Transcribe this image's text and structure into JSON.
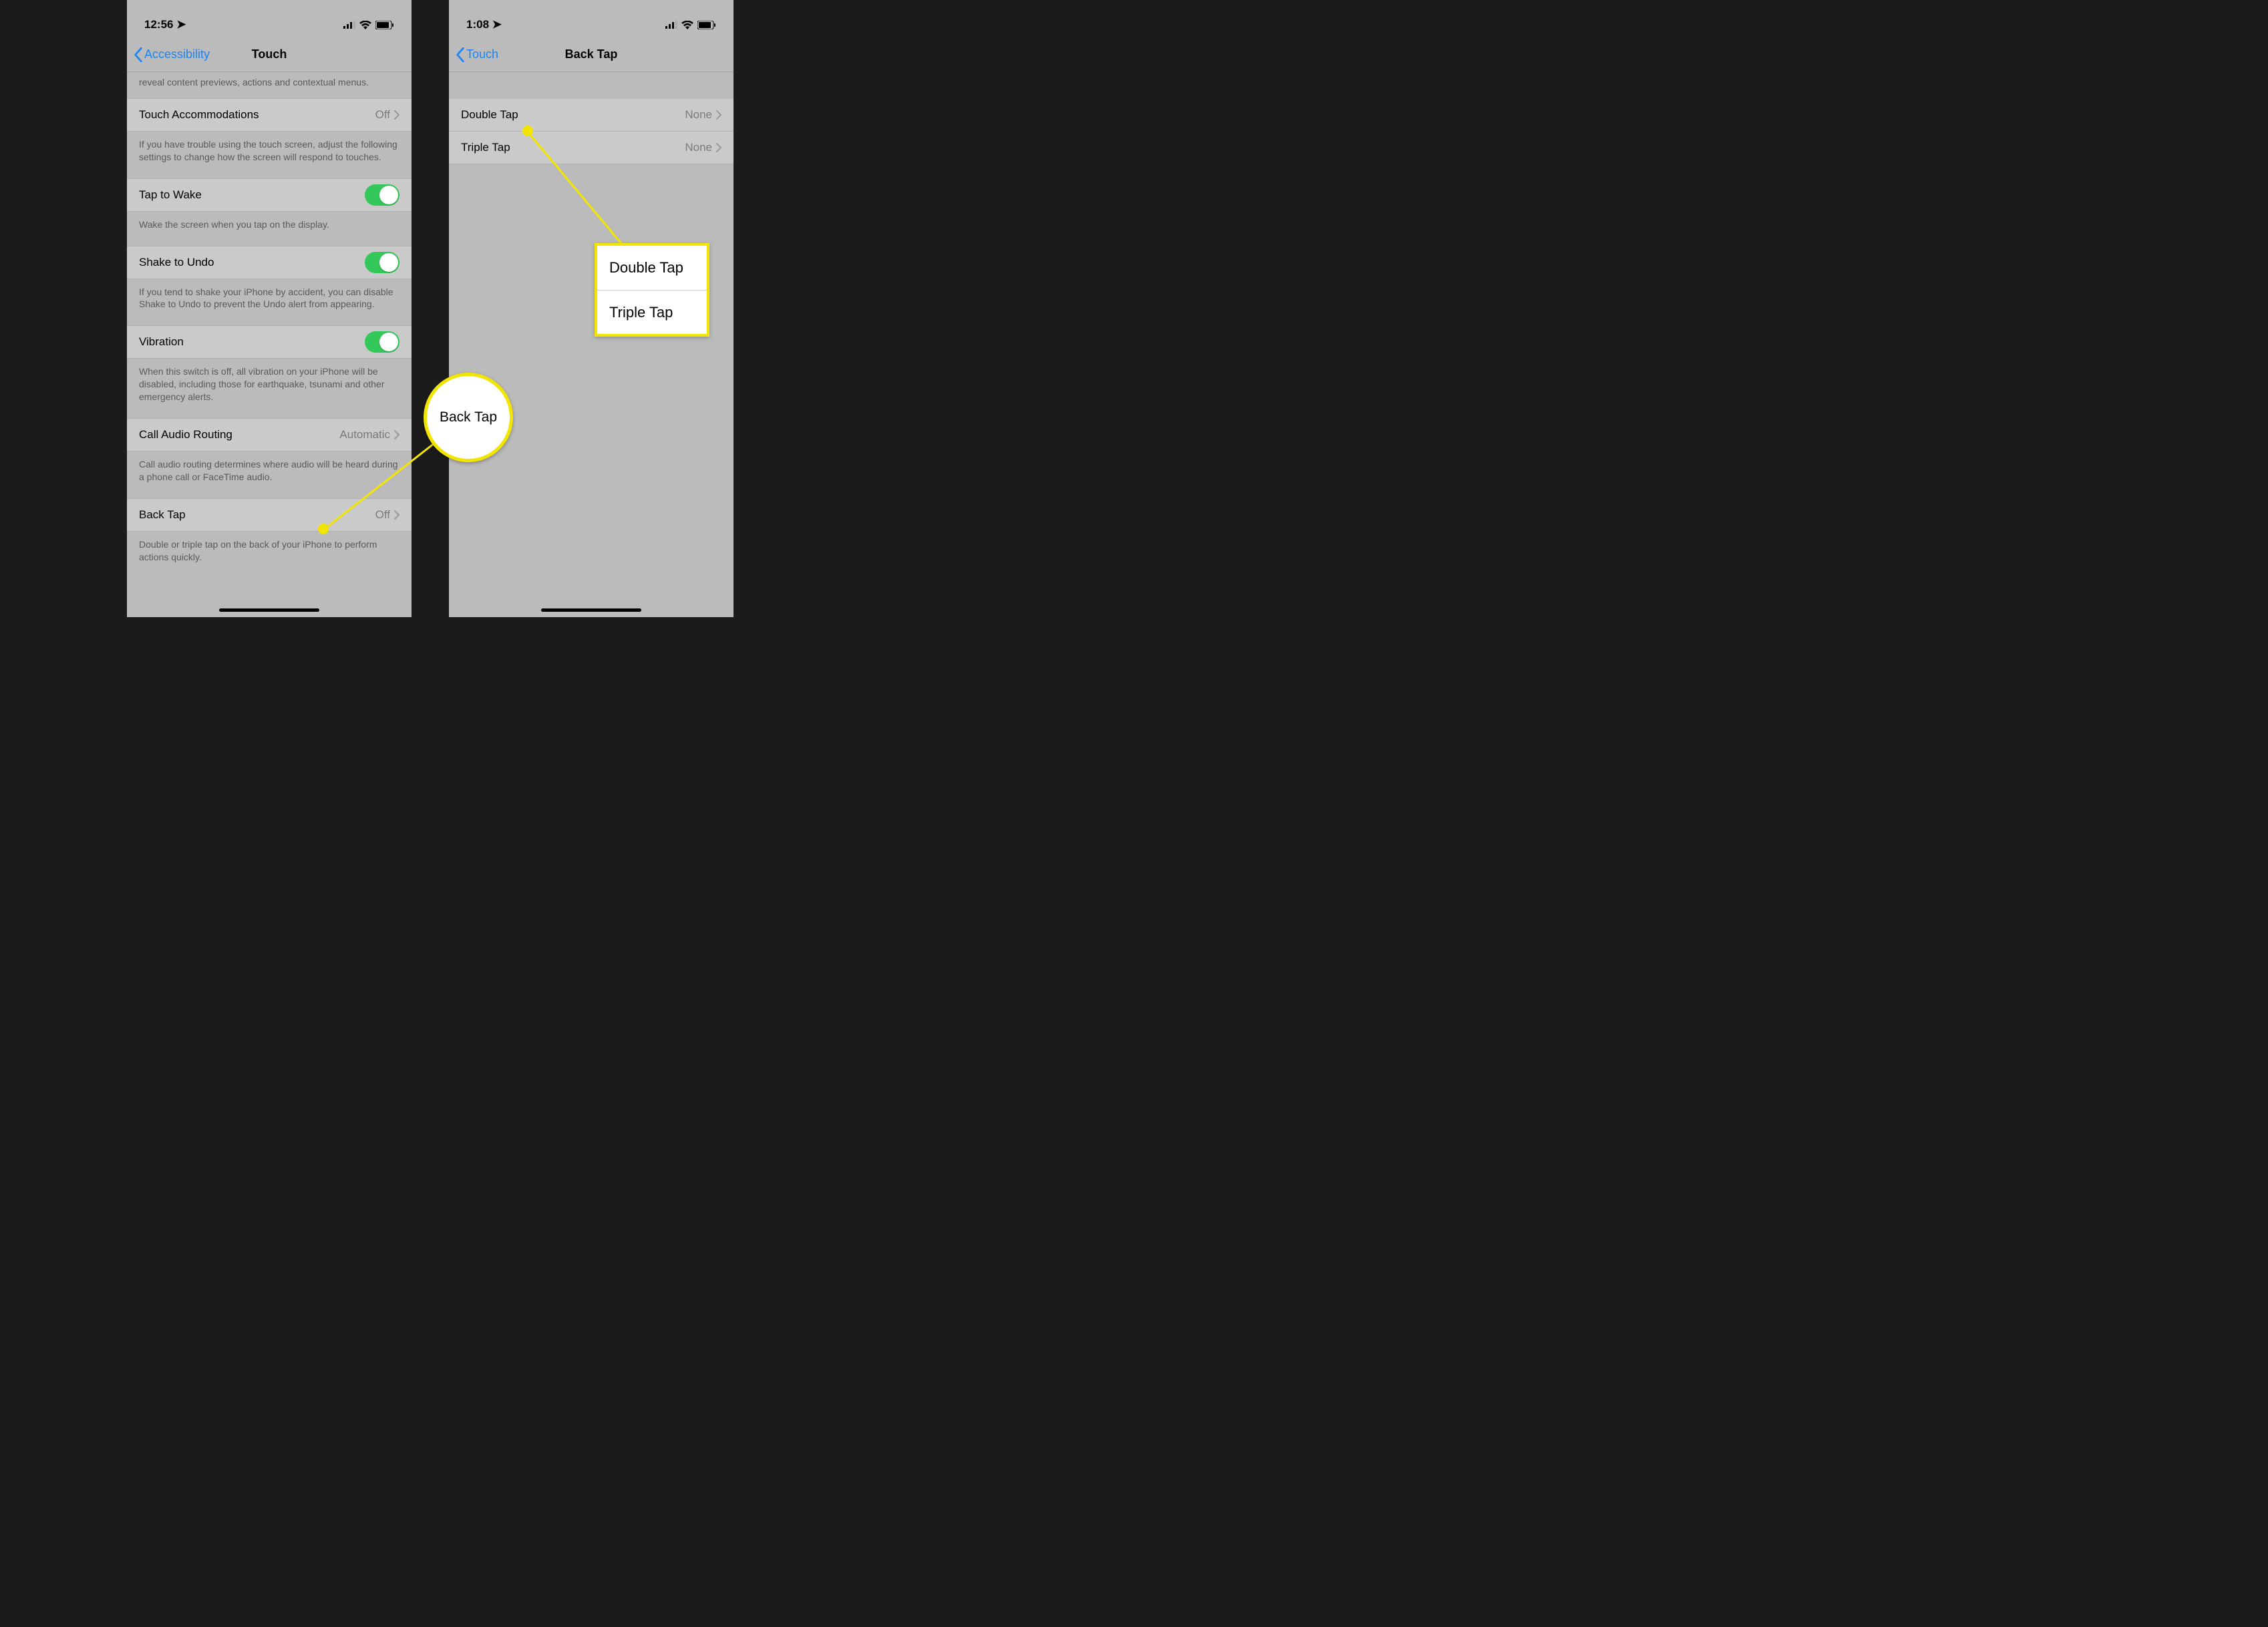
{
  "left": {
    "status": {
      "time": "12:56"
    },
    "nav": {
      "back": "Accessibility",
      "title": "Touch"
    },
    "intro_footer": "reveal content previews, actions and contextual menus.",
    "rows": {
      "touch_accommodations": {
        "label": "Touch Accommodations",
        "value": "Off",
        "footer": "If you have trouble using the touch screen, adjust the following settings to change how the screen will respond to touches."
      },
      "tap_to_wake": {
        "label": "Tap to Wake",
        "footer": "Wake the screen when you tap on the display."
      },
      "shake_to_undo": {
        "label": "Shake to Undo",
        "footer": "If you tend to shake your iPhone by accident, you can disable Shake to Undo to prevent the Undo alert from appearing."
      },
      "vibration": {
        "label": "Vibration",
        "footer": "When this switch is off, all vibration on your iPhone will be disabled, including those for earthquake, tsunami and other emergency alerts."
      },
      "call_audio": {
        "label": "Call Audio Routing",
        "value": "Automatic",
        "footer": "Call audio routing determines where audio will be heard during a phone call or FaceTime audio."
      },
      "back_tap": {
        "label": "Back Tap",
        "value": "Off",
        "footer": "Double or triple tap on the back of your iPhone to perform actions quickly."
      }
    },
    "callout": {
      "label": "Back Tap"
    }
  },
  "right": {
    "status": {
      "time": "1:08"
    },
    "nav": {
      "back": "Touch",
      "title": "Back Tap"
    },
    "rows": {
      "double_tap": {
        "label": "Double Tap",
        "value": "None"
      },
      "triple_tap": {
        "label": "Triple Tap",
        "value": "None"
      }
    },
    "callout": {
      "row1": "Double Tap",
      "row2": "Triple Tap"
    }
  }
}
